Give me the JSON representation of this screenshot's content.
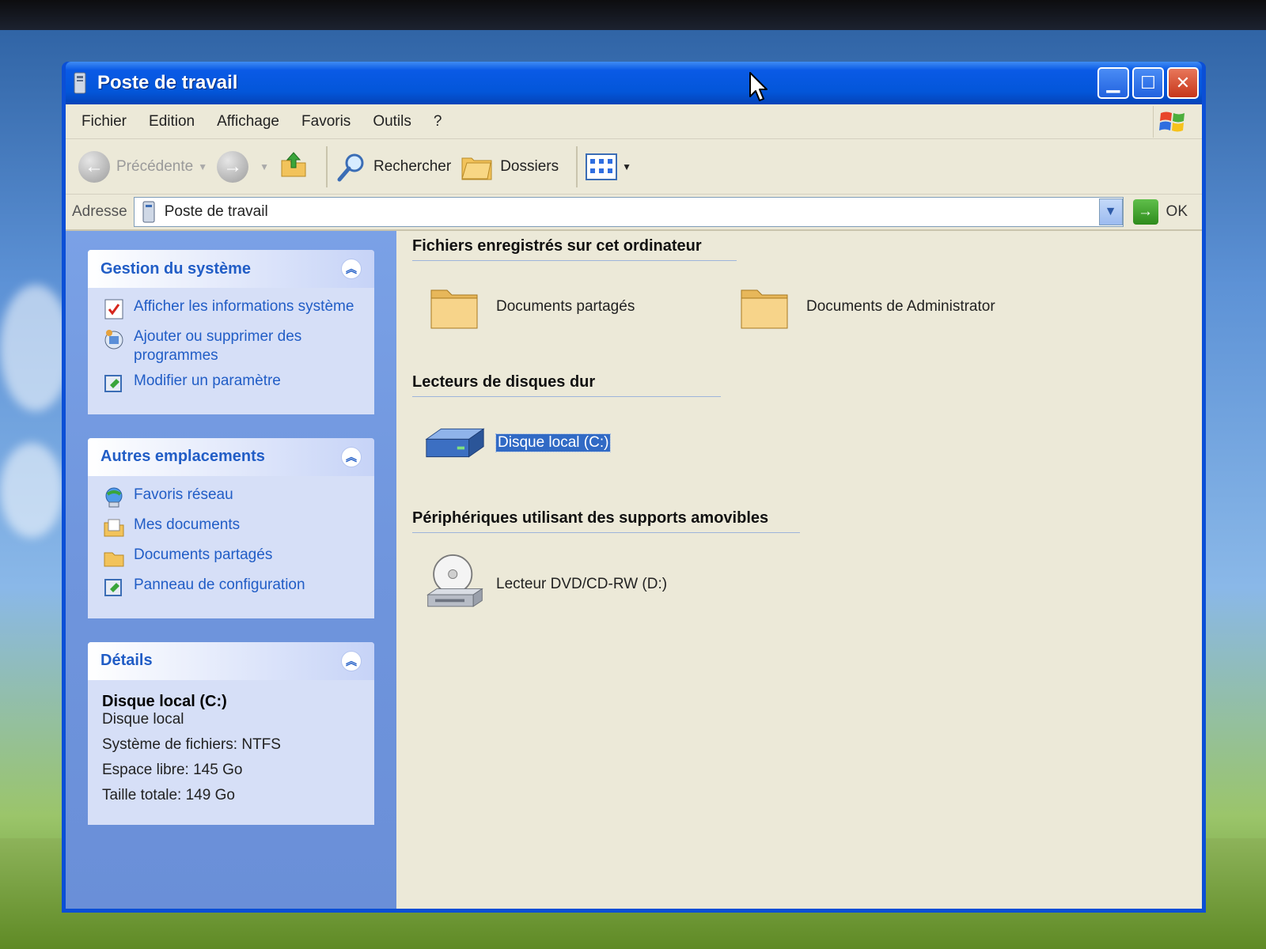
{
  "window": {
    "title": "Poste de travail",
    "controls": [
      "minimize",
      "maximize",
      "close"
    ]
  },
  "menu": [
    "Fichier",
    "Edition",
    "Affichage",
    "Favoris",
    "Outils",
    "?"
  ],
  "toolbar": {
    "back_label": "Précédente",
    "search_label": "Rechercher",
    "folders_label": "Dossiers"
  },
  "address": {
    "label": "Adresse",
    "value": "Poste de travail",
    "go_label": "OK"
  },
  "sidebar": {
    "system_tasks": {
      "title": "Gestion du système",
      "items": [
        {
          "label": "Afficher les informations système",
          "icon": "system-info-icon"
        },
        {
          "label": "Ajouter ou supprimer des programmes",
          "icon": "add-remove-programs-icon"
        },
        {
          "label": "Modifier un paramètre",
          "icon": "control-panel-icon"
        }
      ]
    },
    "other_places": {
      "title": "Autres emplacements",
      "items": [
        {
          "label": "Favoris réseau",
          "icon": "network-places-icon"
        },
        {
          "label": "Mes documents",
          "icon": "my-documents-icon"
        },
        {
          "label": "Documents partagés",
          "icon": "shared-documents-icon"
        },
        {
          "label": "Panneau de configuration",
          "icon": "control-panel-icon"
        }
      ]
    },
    "details": {
      "title": "Détails",
      "name": "Disque local (C:)",
      "type": "Disque local",
      "filesystem": "Système de fichiers: NTFS",
      "free_space": "Espace libre: 145 Go",
      "total_size": "Taille totale: 149 Go"
    }
  },
  "content": {
    "groups": [
      {
        "title": "Fichiers enregistrés sur cet ordinateur",
        "items": [
          {
            "label": "Documents partagés",
            "icon": "folder-icon"
          },
          {
            "label": "Documents de Administrator",
            "icon": "folder-icon"
          }
        ]
      },
      {
        "title": "Lecteurs de disques dur",
        "items": [
          {
            "label": "Disque local (C:)",
            "icon": "hard-drive-icon",
            "selected": true
          }
        ]
      },
      {
        "title": "Périphériques utilisant des supports amovibles",
        "items": [
          {
            "label": "Lecteur DVD/CD-RW (D:)",
            "icon": "dvd-drive-icon"
          }
        ]
      }
    ]
  },
  "colors": {
    "titlebar": "#0356d9",
    "sidebar": "#6f95dd",
    "task_link": "#215dc6",
    "selection": "#316ac5",
    "window_bg": "#ece9d8"
  }
}
